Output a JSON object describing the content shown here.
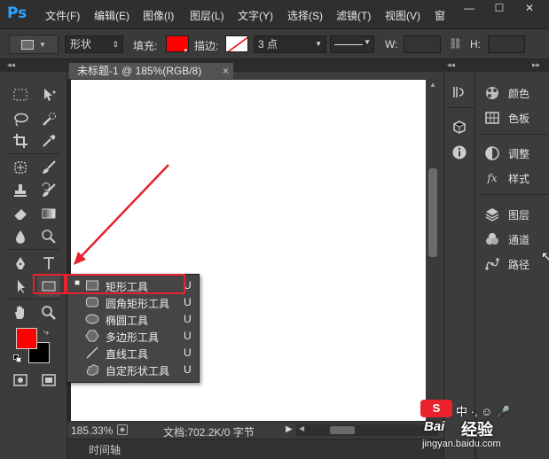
{
  "app": {
    "logo_text": "Ps",
    "menus": [
      "文件(F)",
      "编辑(E)",
      "图像(I)",
      "图层(L)",
      "文字(Y)",
      "选择(S)",
      "滤镜(T)",
      "视图(V)",
      "窗"
    ]
  },
  "window_controls": {
    "minimize": "—",
    "maximize": "☐",
    "close": "✕"
  },
  "options_bar": {
    "mode_value": "形状",
    "fill_label": "填充:",
    "fill_color": "#ff0000",
    "stroke_label": "描边:",
    "stroke_width_value": "3 点",
    "w_label": "W:",
    "h_label": "H:"
  },
  "document": {
    "tab_title": "未标题-1 @ 185%(RGB/8)",
    "tab_close": "×",
    "zoom": "185.33%",
    "doc_info": "文档:702.2K/0 字节"
  },
  "timeline": {
    "label": "时间轴"
  },
  "colors": {
    "foreground": "#ff0000",
    "background": "#000000",
    "highlight": "#e8212d",
    "accent_blue": "#2fa3ff"
  },
  "right_panel": {
    "items": [
      {
        "label": "颜色",
        "icon": "color-wheel-icon"
      },
      {
        "label": "色板",
        "icon": "swatches-icon"
      },
      {
        "label": "调整",
        "icon": "adjustments-icon"
      },
      {
        "label": "样式",
        "icon": "fx-styles-icon"
      },
      {
        "label": "图层",
        "icon": "layers-icon"
      },
      {
        "label": "通道",
        "icon": "channels-icon"
      },
      {
        "label": "路径",
        "icon": "paths-icon"
      }
    ]
  },
  "shape_menu": {
    "items": [
      {
        "label": "矩形工具",
        "key": "U",
        "selected": true,
        "icon": "rectangle-icon"
      },
      {
        "label": "圆角矩形工具",
        "key": "U",
        "selected": false,
        "icon": "rounded-rectangle-icon"
      },
      {
        "label": "椭圆工具",
        "key": "U",
        "selected": false,
        "icon": "ellipse-icon"
      },
      {
        "label": "多边形工具",
        "key": "U",
        "selected": false,
        "icon": "polygon-icon"
      },
      {
        "label": "直线工具",
        "key": "U",
        "selected": false,
        "icon": "line-icon"
      },
      {
        "label": "自定形状工具",
        "key": "U",
        "selected": false,
        "icon": "custom-shape-icon"
      }
    ]
  },
  "watermark": {
    "logo_text": "Bai",
    "site": "jingyan.baidu.com",
    "brand": "经验"
  }
}
